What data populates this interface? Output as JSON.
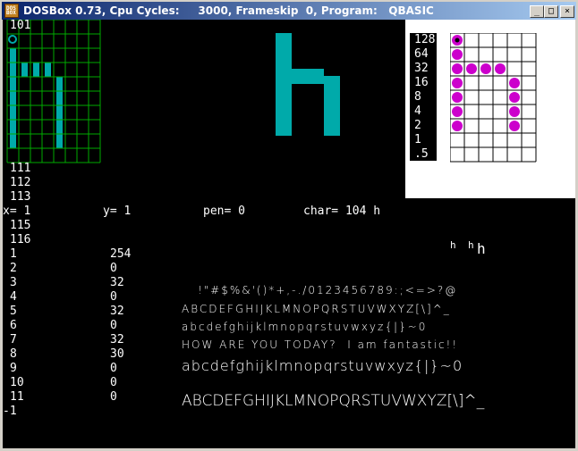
{
  "window": {
    "title": "DOSBox 0.73, Cpu Cycles:     3000, Frameskip  0, Program:   QBASIC",
    "icon": "dosbox-icon",
    "icon_text": "DOS\nBOX",
    "buttons": {
      "minimize": "_",
      "maximize": "□",
      "close": "×"
    }
  },
  "screen": {
    "cyan": "#00aaaa",
    "magenta": "#cc00cc",
    "grid_green": "#00aa00",
    "top_number": "101",
    "char_list": [
      "111",
      "112",
      "113"
    ],
    "status": {
      "x": "x= 1",
      "y": "y= 1",
      "pen": "pen= 0",
      "char": "char= 104 h"
    },
    "list2": [
      "115",
      "116"
    ],
    "rows": [
      {
        "index": "1",
        "value": "254"
      },
      {
        "index": "2",
        "value": "0"
      },
      {
        "index": "3",
        "value": "32"
      },
      {
        "index": "4",
        "value": "0"
      },
      {
        "index": "5",
        "value": "32"
      },
      {
        "index": "6",
        "value": "0"
      },
      {
        "index": "7",
        "value": "32"
      },
      {
        "index": "8",
        "value": "30"
      },
      {
        "index": "9",
        "value": "0"
      },
      {
        "index": "10",
        "value": "0"
      },
      {
        "index": "11",
        "value": "0"
      }
    ],
    "footer_number": "-1",
    "preview_small": [
      "h",
      "h",
      "h"
    ],
    "font_lines": [
      " !\"#$%&'()*+,-./0123456789:;<=>?@",
      "ABCDEFGHIJKLMNOPQRSTUVWXYZ[\\]^_",
      "abcdefghijklmnopqrstuvwxyz{|}~0",
      "HOW ARE YOU TODAY?  I am fantastic!!",
      "abcdefghijklmnopqrstuvwxyz{|}~0",
      "ABCDEFGHIJKLMNOPQRSTUVWXYZ[\\]^_"
    ],
    "bit_labels": [
      "128",
      "64",
      "32",
      "16",
      "8",
      "4",
      "2",
      "1",
      ".5"
    ]
  }
}
